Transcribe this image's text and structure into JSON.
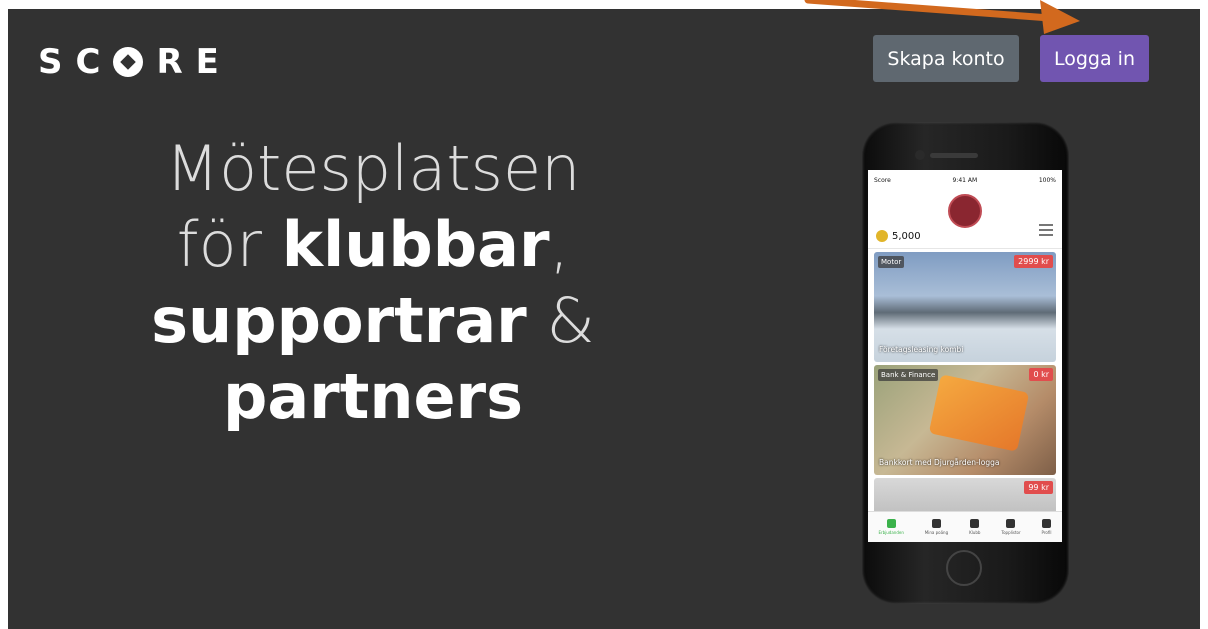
{
  "header": {
    "logo_pre": "SC",
    "logo_post": "RE",
    "create_account_label": "Skapa konto",
    "login_label": "Logga in"
  },
  "hero": {
    "line1": "Mötesplatsen",
    "line2_light": "för",
    "line2_bold": "klubbar",
    "line2_punct": ",",
    "line3_bold": "supportrar",
    "line3_light": "&",
    "line4_bold": "partners"
  },
  "phone": {
    "status_carrier": "Score",
    "status_time": "9:41 AM",
    "status_battery": "100%",
    "points": "5,000",
    "cards": [
      {
        "category": "Motor",
        "price": "2999 kr",
        "title": "Företagsleasing kombi"
      },
      {
        "category": "Bank & Finance",
        "price": "0 kr",
        "title": "Bankkort med Djurgården-logga"
      },
      {
        "category": "",
        "price": "99 kr",
        "title": ""
      }
    ],
    "tabs": [
      {
        "label": "Erbjudanden",
        "icon": "tag-icon"
      },
      {
        "label": "Mina poäng",
        "icon": "points-icon"
      },
      {
        "label": "Klubb",
        "icon": "club-icon"
      },
      {
        "label": "Topplistor",
        "icon": "star-icon"
      },
      {
        "label": "Profil",
        "icon": "profile-icon"
      }
    ]
  },
  "colors": {
    "background": "#323232",
    "create_button": "#5f6870",
    "login_button": "#7155b0",
    "annotation_arrow": "#d2691e"
  }
}
